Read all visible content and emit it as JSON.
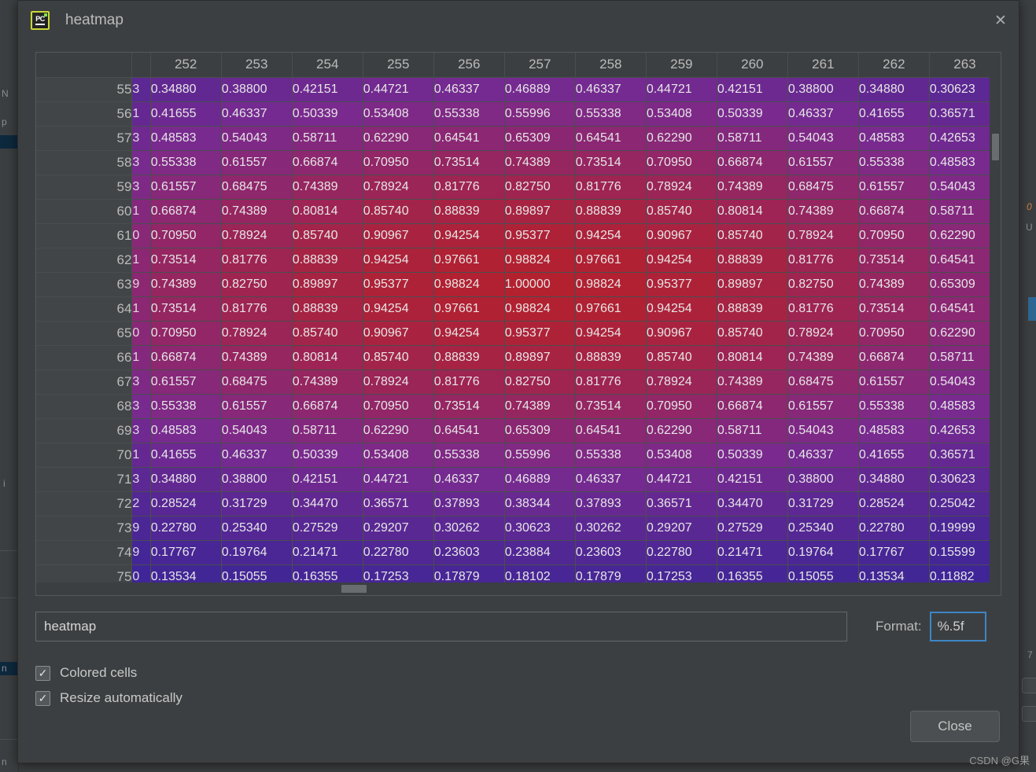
{
  "window": {
    "title": "heatmap",
    "app_icon": "pycharm-icon",
    "close_icon": "close-icon"
  },
  "watermark": "CSDN @G果",
  "controls": {
    "name_value": "heatmap",
    "name_placeholder": "",
    "format_label": "Format:",
    "format_value": "%.5f",
    "colored_cells_label": "Colored cells",
    "colored_cells_checked": true,
    "resize_automatically_label": "Resize automatically",
    "resize_automatically_checked": true,
    "check_glyph": "✓",
    "close_button_label": "Close"
  },
  "colors": {
    "dialog_bg": "#3c3f41",
    "text": "#bbbbbb",
    "focus_accent": "#3d86c6",
    "heat_min": "#2c2499",
    "heat_mid": "#7a2a8f",
    "heat_max": "#b3212f"
  },
  "chart_data": {
    "type": "heatmap",
    "title": "heatmap",
    "xlabel": "",
    "ylabel": "",
    "value_format": "%.5f",
    "vmin": 0.0,
    "vmax": 1.0,
    "colormap_stops": [
      "#2c2499",
      "#7a2a8f",
      "#b3212f"
    ],
    "columns": [
      "252",
      "253",
      "254",
      "255",
      "256",
      "257",
      "258",
      "259",
      "260",
      "261",
      "262",
      "263"
    ],
    "rows": [
      "55",
      "56",
      "57",
      "58",
      "59",
      "60",
      "61",
      "62",
      "63",
      "64",
      "65",
      "66",
      "67",
      "68",
      "69",
      "70",
      "71",
      "72",
      "73",
      "74",
      "75"
    ],
    "clipped_left_column_digits": [
      "3",
      "1",
      "3",
      "3",
      "3",
      "1",
      "0",
      "1",
      "9",
      "1",
      "0",
      "1",
      "3",
      "3",
      "3",
      "1",
      "3",
      "2",
      "9",
      "9",
      "0"
    ],
    "values": [
      [
        0.3488,
        0.388,
        0.42151,
        0.44721,
        0.46337,
        0.46889,
        0.46337,
        0.44721,
        0.42151,
        0.388,
        0.3488,
        0.30623
      ],
      [
        0.41655,
        0.46337,
        0.50339,
        0.53408,
        0.55338,
        0.55996,
        0.55338,
        0.53408,
        0.50339,
        0.46337,
        0.41655,
        0.36571
      ],
      [
        0.48583,
        0.54043,
        0.58711,
        0.6229,
        0.64541,
        0.65309,
        0.64541,
        0.6229,
        0.58711,
        0.54043,
        0.48583,
        0.42653
      ],
      [
        0.55338,
        0.61557,
        0.66874,
        0.7095,
        0.73514,
        0.74389,
        0.73514,
        0.7095,
        0.66874,
        0.61557,
        0.55338,
        0.48583
      ],
      [
        0.61557,
        0.68475,
        0.74389,
        0.78924,
        0.81776,
        0.8275,
        0.81776,
        0.78924,
        0.74389,
        0.68475,
        0.61557,
        0.54043
      ],
      [
        0.66874,
        0.74389,
        0.80814,
        0.8574,
        0.88839,
        0.89897,
        0.88839,
        0.8574,
        0.80814,
        0.74389,
        0.66874,
        0.58711
      ],
      [
        0.7095,
        0.78924,
        0.8574,
        0.90967,
        0.94254,
        0.95377,
        0.94254,
        0.90967,
        0.8574,
        0.78924,
        0.7095,
        0.6229
      ],
      [
        0.73514,
        0.81776,
        0.88839,
        0.94254,
        0.97661,
        0.98824,
        0.97661,
        0.94254,
        0.88839,
        0.81776,
        0.73514,
        0.64541
      ],
      [
        0.74389,
        0.8275,
        0.89897,
        0.95377,
        0.98824,
        1.0,
        0.98824,
        0.95377,
        0.89897,
        0.8275,
        0.74389,
        0.65309
      ],
      [
        0.73514,
        0.81776,
        0.88839,
        0.94254,
        0.97661,
        0.98824,
        0.97661,
        0.94254,
        0.88839,
        0.81776,
        0.73514,
        0.64541
      ],
      [
        0.7095,
        0.78924,
        0.8574,
        0.90967,
        0.94254,
        0.95377,
        0.94254,
        0.90967,
        0.8574,
        0.78924,
        0.7095,
        0.6229
      ],
      [
        0.66874,
        0.74389,
        0.80814,
        0.8574,
        0.88839,
        0.89897,
        0.88839,
        0.8574,
        0.80814,
        0.74389,
        0.66874,
        0.58711
      ],
      [
        0.61557,
        0.68475,
        0.74389,
        0.78924,
        0.81776,
        0.8275,
        0.81776,
        0.78924,
        0.74389,
        0.68475,
        0.61557,
        0.54043
      ],
      [
        0.55338,
        0.61557,
        0.66874,
        0.7095,
        0.73514,
        0.74389,
        0.73514,
        0.7095,
        0.66874,
        0.61557,
        0.55338,
        0.48583
      ],
      [
        0.48583,
        0.54043,
        0.58711,
        0.6229,
        0.64541,
        0.65309,
        0.64541,
        0.6229,
        0.58711,
        0.54043,
        0.48583,
        0.42653
      ],
      [
        0.41655,
        0.46337,
        0.50339,
        0.53408,
        0.55338,
        0.55996,
        0.55338,
        0.53408,
        0.50339,
        0.46337,
        0.41655,
        0.36571
      ],
      [
        0.3488,
        0.388,
        0.42151,
        0.44721,
        0.46337,
        0.46889,
        0.46337,
        0.44721,
        0.42151,
        0.388,
        0.3488,
        0.30623
      ],
      [
        0.28524,
        0.31729,
        0.3447,
        0.36571,
        0.37893,
        0.38344,
        0.37893,
        0.36571,
        0.3447,
        0.31729,
        0.28524,
        0.25042
      ],
      [
        0.2278,
        0.2534,
        0.27529,
        0.29207,
        0.30262,
        0.30623,
        0.30262,
        0.29207,
        0.27529,
        0.2534,
        0.2278,
        0.19999
      ],
      [
        0.17767,
        0.19764,
        0.21471,
        0.2278,
        0.23603,
        0.23884,
        0.23603,
        0.2278,
        0.21471,
        0.19764,
        0.17767,
        0.15599
      ],
      [
        0.13534,
        0.15055,
        0.16355,
        0.17253,
        0.17879,
        0.18102,
        0.17879,
        0.17253,
        0.16355,
        0.15055,
        0.13534,
        0.11882
      ]
    ]
  },
  "backdrop": {
    "labels": [
      "N",
      "p",
      "i",
      "n",
      "n"
    ]
  }
}
